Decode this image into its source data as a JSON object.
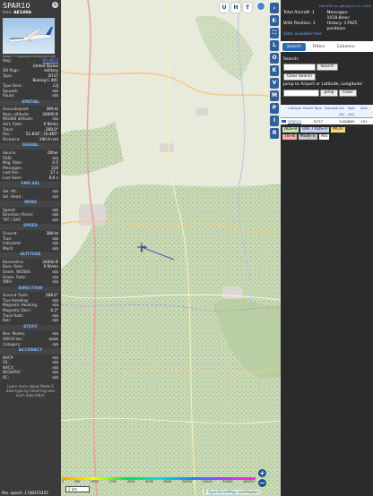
{
  "left_panel": {
    "callsign": "SPAR10",
    "hex_label": "Hex:",
    "hex": "AE149A",
    "close": "×",
    "photo_credit": "Image © Alejandro Hernández León",
    "info": [
      {
        "k": "Reg.:",
        "v": "05-4613",
        "link": true
      },
      {
        "k": "",
        "v": "United States"
      },
      {
        "k": "DB flags:",
        "v": "military"
      },
      {
        "k": "Type:",
        "v": "B737"
      },
      {
        "k": "",
        "v": "Boeing C-40C"
      },
      {
        "k": "Type Desc.:",
        "v": "L2J"
      },
      {
        "k": "Squawk:",
        "v": "n/a"
      },
      {
        "k": "Route:",
        "v": "n/a"
      }
    ],
    "spatial_title": "SPATIAL",
    "spatial": [
      {
        "k": "Groundspeed:",
        "v": "389 kt"
      },
      {
        "k": "Baro. altitude:",
        "v": "34000 ft"
      },
      {
        "k": "WGS84 altitude:",
        "v": "n/a"
      },
      {
        "k": "Vert. Rate:",
        "v": "0 ft/min"
      },
      {
        "k": "Track:",
        "v": "268.0°"
      },
      {
        "k": "Pos.:",
        "v": "51.834°, 10.465°"
      },
      {
        "k": "Distance:",
        "v": "190.9 nmi"
      }
    ],
    "signal_title": "SIGNAL",
    "signal": [
      {
        "k": "Source:",
        "v": "Other"
      },
      {
        "k": "RSSI:",
        "v": "n/a"
      },
      {
        "k": "Msg. Rate:",
        "v": "0.5"
      },
      {
        "k": "Messages:",
        "v": "116"
      },
      {
        "k": "Last Pos.:",
        "v": "27 s"
      },
      {
        "k": "Last Seen:",
        "v": "0.6 s"
      }
    ],
    "fms_title": "FMS SEL",
    "fms": [
      {
        "k": "Sel. Alt.:",
        "v": "n/a"
      },
      {
        "k": "Sel. Head.:",
        "v": "n/a"
      }
    ],
    "wind_title": "WIND",
    "wind": [
      {
        "k": "Speed:",
        "v": "n/a"
      },
      {
        "k": "Direction (from):",
        "v": "n/a"
      },
      {
        "k": "TAT / OAT:",
        "v": "n/a"
      }
    ],
    "speed_title": "SPEED",
    "speed": [
      {
        "k": "Ground:",
        "v": "389 kt"
      },
      {
        "k": "True:",
        "v": "n/a"
      },
      {
        "k": "Indicated:",
        "v": "n/a"
      },
      {
        "k": "Mach:",
        "v": "n/a"
      }
    ],
    "altitude_title": "ALTITUDE",
    "altitude": [
      {
        "k": "Barometric:",
        "v": "34000 ft"
      },
      {
        "k": "Baro. Rate:",
        "v": "0 ft/min"
      },
      {
        "k": "Geom. WGS84:",
        "v": "n/a"
      },
      {
        "k": "Geom. Rate:",
        "v": "n/a"
      },
      {
        "k": "QNH:",
        "v": "n/a"
      }
    ],
    "direction_title": "DIRECTION",
    "direction": [
      {
        "k": "Ground Track:",
        "v": "268.0°"
      },
      {
        "k": "True Heading:",
        "v": "n/a"
      },
      {
        "k": "Magnetic Heading:",
        "v": "n/a"
      },
      {
        "k": "Magnetic Decl.:",
        "v": "4.3°"
      },
      {
        "k": "Track Rate:",
        "v": "n/a"
      },
      {
        "k": "Roll:",
        "v": "n/a"
      }
    ],
    "stuff_title": "STUFF",
    "stuff": [
      {
        "k": "Nav. Modes:",
        "v": "n/a"
      },
      {
        "k": "ADS-B Ver.:",
        "v": "none"
      },
      {
        "k": "Category:",
        "v": "n/a"
      }
    ],
    "accuracy_title": "ACCURACY",
    "accuracy": [
      {
        "k": "NACP:",
        "v": "n/a"
      },
      {
        "k": "SIL:",
        "v": "n/a"
      },
      {
        "k": "NACV:",
        "v": "n/a"
      },
      {
        "k": "NICBARO:",
        "v": "n/a"
      },
      {
        "k": "RC:",
        "v": "n/a"
      }
    ],
    "note": "Learn more about Mode S data type by hovering over each data label.",
    "epoch_label": "Pos. epoch:",
    "epoch": "1748372455"
  },
  "map_buttons": {
    "top": [
      "U",
      "H",
      "T"
    ],
    "vertical": [
      "L",
      "O",
      "K",
      "V",
      "M",
      "P",
      "I",
      "R"
    ],
    "zoom_in": "+",
    "zoom_out": "−",
    "scale": "2 km",
    "attribution_prefix": "© ",
    "attribution_link": "OpenStreetMap",
    "attribution_suffix": " contributors"
  },
  "altitude_legend": [
    "0",
    "500",
    "1000",
    "2000",
    "4000",
    "6000",
    "8000",
    "10000",
    "20000",
    "30000",
    "40000+"
  ],
  "right_panel": {
    "top_link_prefix": "",
    "top_link": "tar1090 on github (3.14.1700)",
    "stats": [
      {
        "k": "Total Aircraft:",
        "v": "1"
      },
      {
        "k": "Messages:",
        "v": "1018.8/sec"
      },
      {
        "k": "With Position:",
        "v": "1"
      },
      {
        "k": "History:",
        "v": "17925 positions"
      }
    ],
    "stats_link": "Stats available here",
    "tabs": [
      "Search",
      "Filters",
      "Columns"
    ],
    "search_label": "Search:",
    "search_button": "Search",
    "clear_search": "Clear Search",
    "jump_label": "Jump to Airport or Latitude, Longitude:",
    "jump_button": "Jump",
    "clear_button": "Clear",
    "table_headers": [
      "",
      "Callsign",
      "Route",
      "Type",
      "Squawk",
      "Alt. (ft)",
      "Spd. (kt)",
      "Dist."
    ],
    "table_row": [
      "",
      "SPAR10",
      "",
      "B737",
      "",
      "34000",
      "389",
      "191"
    ],
    "legend": [
      {
        "label": "ADS-B",
        "color": "#c4e3b9"
      },
      {
        "label": "UAT / ADS-R",
        "color": "#c3d5f1"
      },
      {
        "label": "MLAT",
        "color": "#f9db7d"
      },
      {
        "label": "TIS-B",
        "color": "#f6aeab"
      },
      {
        "label": "Mode-S",
        "color": "#c8c8c8"
      },
      {
        "label": "AIS",
        "color": "#ffffff"
      }
    ]
  }
}
